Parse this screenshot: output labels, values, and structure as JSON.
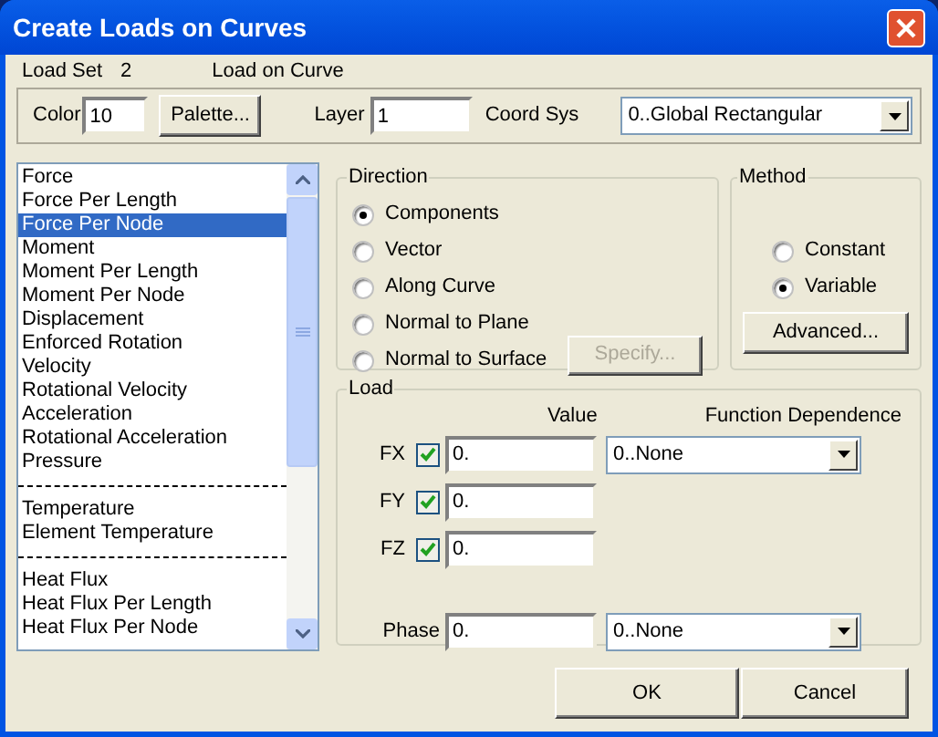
{
  "window": {
    "title": "Create Loads on Curves"
  },
  "header": {
    "load_set_label": "Load Set",
    "load_set_value": "2",
    "load_type": "Load on Curve"
  },
  "props": {
    "color_label": "Color",
    "color_value": "10",
    "palette_button": "Palette...",
    "layer_label": "Layer",
    "layer_value": "1",
    "coord_sys_label": "Coord Sys",
    "coord_sys_value": "0..Global Rectangular"
  },
  "load_types": [
    {
      "kind": "item",
      "label": "Force",
      "selected": false
    },
    {
      "kind": "item",
      "label": "Force Per Length",
      "selected": false
    },
    {
      "kind": "item",
      "label": "Force Per Node",
      "selected": true
    },
    {
      "kind": "item",
      "label": "Moment",
      "selected": false
    },
    {
      "kind": "item",
      "label": "Moment Per Length",
      "selected": false
    },
    {
      "kind": "item",
      "label": "Moment Per Node",
      "selected": false
    },
    {
      "kind": "item",
      "label": "Displacement",
      "selected": false
    },
    {
      "kind": "item",
      "label": "Enforced Rotation",
      "selected": false
    },
    {
      "kind": "item",
      "label": "Velocity",
      "selected": false
    },
    {
      "kind": "item",
      "label": "Rotational Velocity",
      "selected": false
    },
    {
      "kind": "item",
      "label": "Acceleration",
      "selected": false
    },
    {
      "kind": "item",
      "label": "Rotational Acceleration",
      "selected": false
    },
    {
      "kind": "item",
      "label": "Pressure",
      "selected": false
    },
    {
      "kind": "separator"
    },
    {
      "kind": "item",
      "label": "Temperature",
      "selected": false
    },
    {
      "kind": "item",
      "label": "Element Temperature",
      "selected": false
    },
    {
      "kind": "separator"
    },
    {
      "kind": "item",
      "label": "Heat Flux",
      "selected": false
    },
    {
      "kind": "item",
      "label": "Heat Flux Per Length",
      "selected": false
    },
    {
      "kind": "item",
      "label": "Heat Flux Per Node",
      "selected": false
    }
  ],
  "direction": {
    "title": "Direction",
    "options": [
      {
        "label": "Components",
        "selected": true
      },
      {
        "label": "Vector",
        "selected": false
      },
      {
        "label": "Along Curve",
        "selected": false
      },
      {
        "label": "Normal to Plane",
        "selected": false
      },
      {
        "label": "Normal to Surface",
        "selected": false
      }
    ],
    "specify_button": {
      "label": "Specify...",
      "disabled": true
    }
  },
  "method": {
    "title": "Method",
    "options": [
      {
        "label": "Constant",
        "selected": false
      },
      {
        "label": "Variable",
        "selected": true
      }
    ],
    "advanced_button": "Advanced..."
  },
  "load": {
    "title": "Load",
    "value_header": "Value",
    "function_header": "Function Dependence",
    "components": [
      {
        "label": "FX",
        "checked": true,
        "value": "0.",
        "function": "0..None"
      },
      {
        "label": "FY",
        "checked": true,
        "value": "0."
      },
      {
        "label": "FZ",
        "checked": true,
        "value": "0."
      }
    ],
    "phase_label": "Phase",
    "phase_value": "0.",
    "phase_function": "0..None"
  },
  "buttons": [
    "OK",
    "Cancel"
  ]
}
